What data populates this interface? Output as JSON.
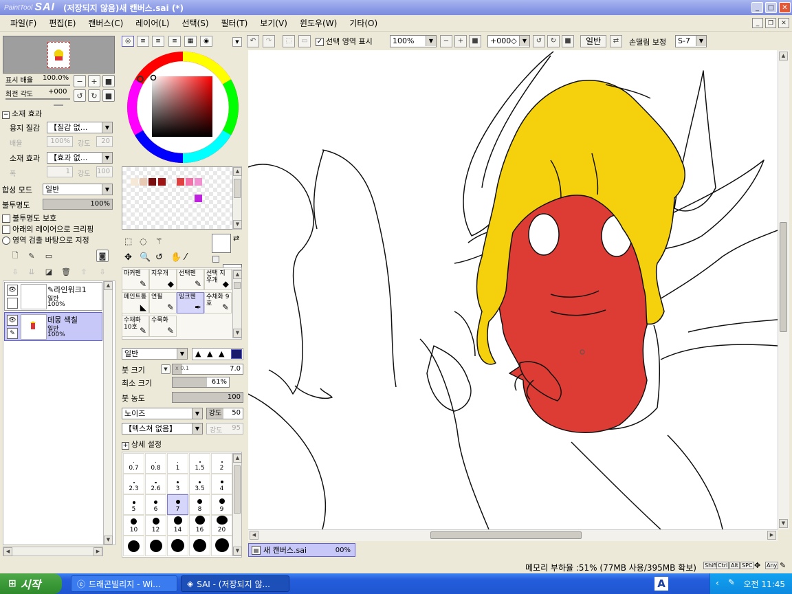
{
  "titlebar": {
    "brand_small": "PaintTool",
    "brand": "SAI",
    "title": "(저장되지 않음)새 캔버스.sai (*)"
  },
  "menu": [
    "파일(F)",
    "편집(E)",
    "캔버스(C)",
    "레이어(L)",
    "선택(S)",
    "필터(T)",
    "보기(V)",
    "윈도우(W)",
    "기타(O)"
  ],
  "navigator": {
    "zoom_label": "표시 배율",
    "zoom_value": "100.0%",
    "rotate_label": "회전 각도",
    "rotate_value": "+000"
  },
  "material": {
    "section": "소재 효과",
    "paper_label": "용지 질감",
    "paper_value": "【질감 없...",
    "scale_label": "배율",
    "scale_value": "100%",
    "strength_label": "강도",
    "strength_value": "20",
    "effect_label": "소재 효과",
    "effect_value": "【효과 없...",
    "width_label": "폭",
    "width_value": "1",
    "strength2_label": "강도",
    "strength2_value": "100"
  },
  "layer_props": {
    "blend_label": "합성 모드",
    "blend_value": "일반",
    "opacity_label": "불투명도",
    "opacity_value": "100%",
    "opacity_fraction": 1.0,
    "protect_label": "불투명도 보호",
    "clip_label": "아래의 레이어으로 크리핑",
    "select_src_label": "영역 검출 바탕으로 지정"
  },
  "layers": [
    {
      "name": "라인워크1",
      "mode": "일반",
      "opacity": "100%",
      "selected": false
    },
    {
      "name": "데몽 색칠",
      "mode": "일반",
      "opacity": "100%",
      "selected": true
    }
  ],
  "palette_colors": [
    "#f6e8d6",
    "#e7c9b4",
    "#7a0e0e",
    "#9e1414",
    "#e04040",
    "#f470a8",
    "#f090d0",
    "#c020e0"
  ],
  "tools": [
    {
      "label": "마커펜",
      "icon": "marker-pen-icon",
      "glyph": "✎",
      "selected": false
    },
    {
      "label": "지우개",
      "icon": "eraser-icon",
      "glyph": "◆",
      "selected": false
    },
    {
      "label": "선택펜",
      "icon": "select-pen-icon",
      "glyph": "✎",
      "selected": false
    },
    {
      "label": "선택 지우개",
      "icon": "select-eraser-icon",
      "glyph": "◆",
      "selected": false
    },
    {
      "label": "페인트통",
      "icon": "paint-bucket-icon",
      "glyph": "◣",
      "selected": false
    },
    {
      "label": "연필",
      "icon": "pencil-icon",
      "glyph": "✎",
      "selected": false
    },
    {
      "label": "잉크펜",
      "icon": "ink-pen-icon",
      "glyph": "✒",
      "selected": true
    },
    {
      "label": "수채화 9호",
      "icon": "watercolor-9-icon",
      "glyph": "✎",
      "selected": false
    },
    {
      "label": "수채화 10호",
      "icon": "watercolor-10-icon",
      "glyph": "✎",
      "selected": false
    },
    {
      "label": "수묵화",
      "icon": "ink-wash-icon",
      "glyph": "✎",
      "selected": false
    }
  ],
  "brush": {
    "mode_value": "일반",
    "size_label": "붓 크기",
    "size_mult": "x 0.1",
    "size_value": "7.0",
    "size_fraction": 0.14,
    "min_label": "최소 크기",
    "min_value": "61%",
    "min_fraction": 0.61,
    "density_label": "붓 농도",
    "density_value": "100",
    "density_fraction": 1.0,
    "noise_value": "노이즈",
    "noise_strength_label": "강도",
    "noise_strength": "50",
    "texture_value": "【텍스쳐 없음】",
    "texture_strength_label": "강도",
    "texture_strength": "95",
    "detail_label": "상세 설정"
  },
  "brush_sizes": [
    {
      "label": "0.7",
      "selected": false
    },
    {
      "label": "0.8",
      "selected": false
    },
    {
      "label": "1",
      "selected": false
    },
    {
      "label": "1.5",
      "selected": false
    },
    {
      "label": "2",
      "selected": false
    },
    {
      "label": "2.3",
      "selected": false
    },
    {
      "label": "2.6",
      "selected": false
    },
    {
      "label": "3",
      "selected": false
    },
    {
      "label": "3.5",
      "selected": false
    },
    {
      "label": "4",
      "selected": false
    },
    {
      "label": "5",
      "selected": false
    },
    {
      "label": "6",
      "selected": false
    },
    {
      "label": "7",
      "selected": true
    },
    {
      "label": "8",
      "selected": false
    },
    {
      "label": "9",
      "selected": false
    },
    {
      "label": "10",
      "selected": false
    },
    {
      "label": "12",
      "selected": false
    },
    {
      "label": "14",
      "selected": false
    },
    {
      "label": "16",
      "selected": false
    },
    {
      "label": "20",
      "selected": false
    },
    {
      "label": "",
      "selected": false
    },
    {
      "label": "",
      "selected": false
    },
    {
      "label": "",
      "selected": false
    },
    {
      "label": "",
      "selected": false
    },
    {
      "label": "",
      "selected": false
    }
  ],
  "canvas_toolbar": {
    "show_selection_label": "선택 영역 표시",
    "zoom_value": "100%",
    "rotate_value": "+000◇",
    "mode_value": "일반",
    "stabilizer_label": "손떨림 보정",
    "stabilizer_value": "S-7"
  },
  "doc_tab": {
    "name": "새 캔버스.sai",
    "percent": "00%"
  },
  "status": {
    "memory": "메모리 부하율 :51% (77MB 사용/395MB 확보)",
    "keys": [
      "Shift",
      "Ctrl",
      "Alt",
      "SPC",
      "Any"
    ]
  },
  "taskbar": {
    "start": "시작",
    "tasks": [
      "드래곤빌리지 - Wi...",
      "SAI - (저장되지 않..."
    ],
    "ime": "A",
    "clock": "오전 11:45"
  }
}
